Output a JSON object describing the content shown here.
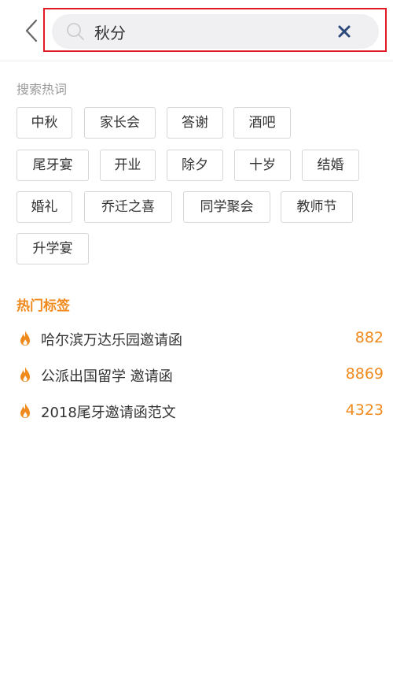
{
  "header": {
    "back_icon": "chevron-left-icon",
    "search_value": "秋分",
    "search_icon": "search-icon",
    "clear_icon": "close-icon",
    "highlight_color": "#e01b24"
  },
  "hot_words": {
    "title": "搜索热词",
    "tags": [
      "中秋",
      "家长会",
      "答谢",
      "酒吧",
      "尾牙宴",
      "开业",
      "除夕",
      "十岁",
      "结婚",
      "婚礼",
      "乔迁之喜",
      "同学聚会",
      "教师节",
      "升学宴"
    ]
  },
  "hot_tags": {
    "title": "热门标签",
    "accent_color": "#f08a1c",
    "items": [
      {
        "label": "哈尔滨万达乐园邀请函",
        "count": "882",
        "icon": "flame-icon"
      },
      {
        "label": "公派出国留学 邀请函",
        "count": "8869",
        "icon": "flame-icon"
      },
      {
        "label": "2018尾牙邀请函范文",
        "count": "4323",
        "icon": "flame-icon"
      }
    ]
  }
}
